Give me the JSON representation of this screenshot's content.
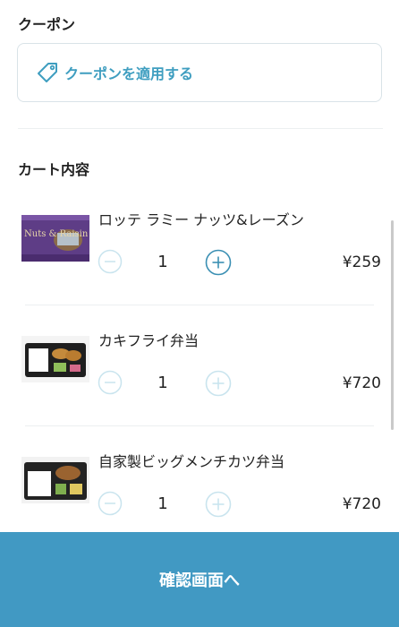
{
  "coupon": {
    "title": "クーポン",
    "apply_label": "クーポンを適用する",
    "icon": "tag-icon"
  },
  "cart": {
    "title": "カート内容",
    "items": [
      {
        "name": "ロッテ ラミー ナッツ&レーズン",
        "quantity": "1",
        "price": "¥259",
        "image_label": "Nuts & Raisin"
      },
      {
        "name": "カキフライ弁当",
        "quantity": "1",
        "price": "¥720"
      },
      {
        "name": "自家製ビッグメンチカツ弁当",
        "quantity": "1",
        "price": "¥720"
      }
    ]
  },
  "footer": {
    "confirm_label": "確認画面へ"
  },
  "colors": {
    "accent": "#4199c3",
    "coupon_text": "#3f9ec0",
    "stepper_enabled": "#3a8fb3",
    "stepper_disabled": "#c9e4ee"
  }
}
